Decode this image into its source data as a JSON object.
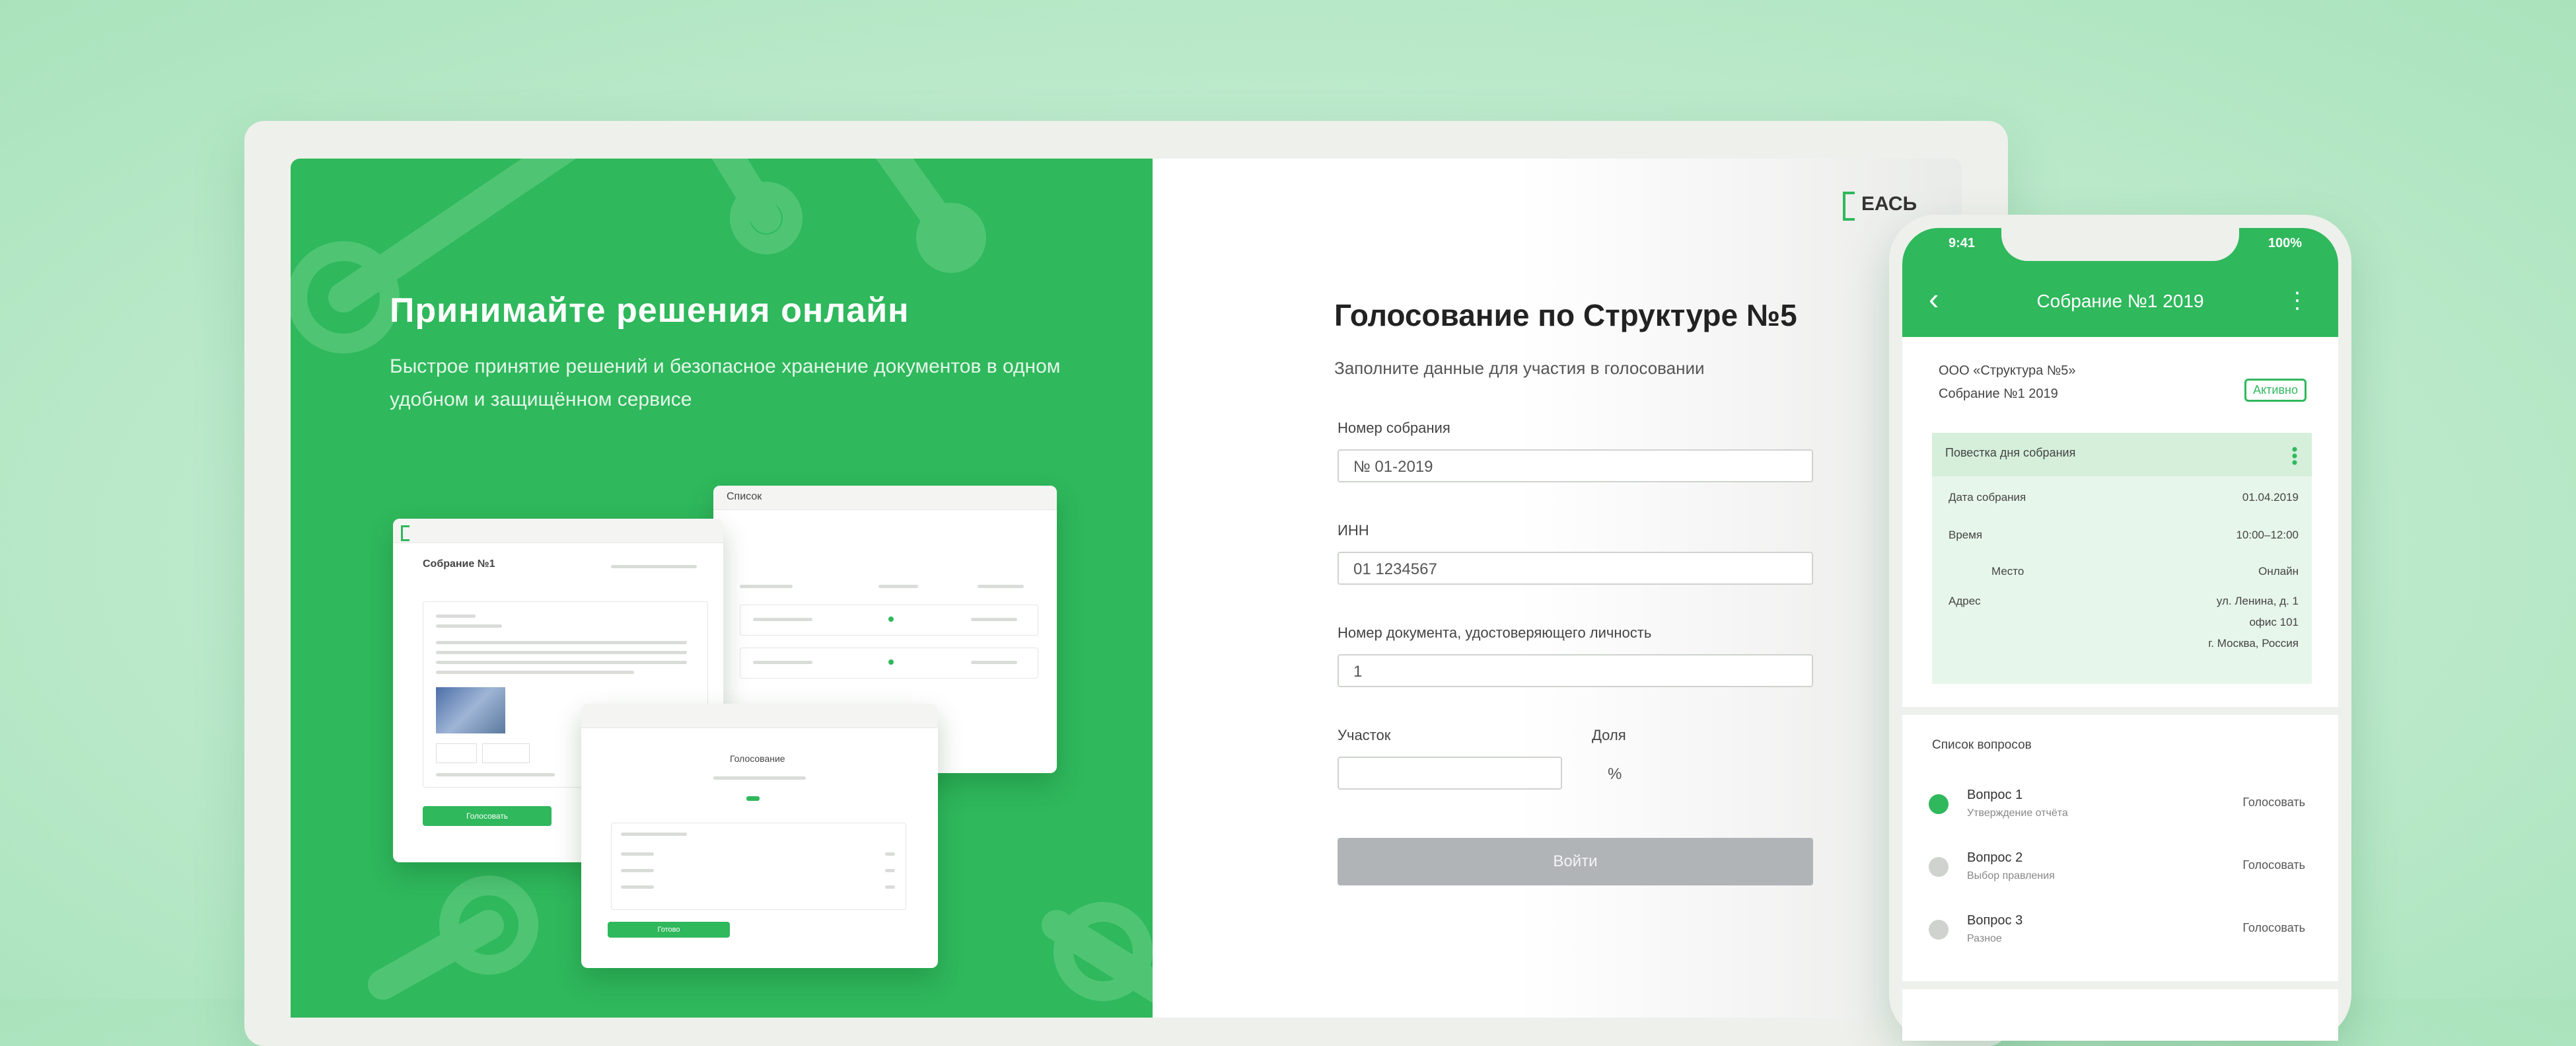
{
  "promo": {
    "title": "Принимайте решения онлайн",
    "subtitle": "Быстрое принятие решений и безопасное хранение документов в одном удобном и защищённом сервисе"
  },
  "mini_windows": {
    "window_a_title": "Собрание №1",
    "window_a_button": "Голосовать",
    "window_b_title": "Список",
    "window_c_title": "Голосование",
    "window_c_button": "Готово"
  },
  "form": {
    "logo_text": "ЕАСЬ",
    "title": "Голосование по Структуре №5",
    "subtitle": "Заполните данные для участия в голосовании",
    "fields": [
      {
        "label": "Номер собрания",
        "value": "№ 01-2019"
      },
      {
        "label": "ИНН",
        "value": "01 1234567"
      },
      {
        "label": "Номер документа, удостоверяющего личность",
        "value": "1"
      },
      {
        "label": "Участок",
        "value": ""
      },
      {
        "label": "Доля",
        "value": "%"
      }
    ],
    "submit_label": "Войти"
  },
  "phone": {
    "time": "9:41",
    "battery": "100%",
    "title": "Собрание №1 2019",
    "org_line1": "ООО «Структура №5»",
    "org_line2": "Собрание №1 2019",
    "badge": "Активно",
    "card_head": "Повестка дня собрания",
    "card_rows": [
      {
        "label": "Дата собрания",
        "value": "01.04.2019"
      },
      {
        "label": "Время",
        "value": "10:00–12:00"
      },
      {
        "label": "Место",
        "value": "Онлайн"
      },
      {
        "label": "Адрес",
        "value": "ул. Ленина, д. 1"
      }
    ],
    "card_extra": [
      "офис 101",
      "г. Москва, Россия"
    ],
    "section_title": "Список вопросов",
    "items": [
      {
        "title": "Вопрос 1",
        "subtitle": "Утверждение отчёта",
        "status": "Голосовать",
        "color": "#2fb85c"
      },
      {
        "title": "Вопрос 2",
        "subtitle": "Выбор правления",
        "status": "Голосовать",
        "color": "#cfd2cf"
      },
      {
        "title": "Вопрос 3",
        "subtitle": "Разное",
        "status": "Голосовать",
        "color": "#cfd2cf"
      }
    ]
  }
}
